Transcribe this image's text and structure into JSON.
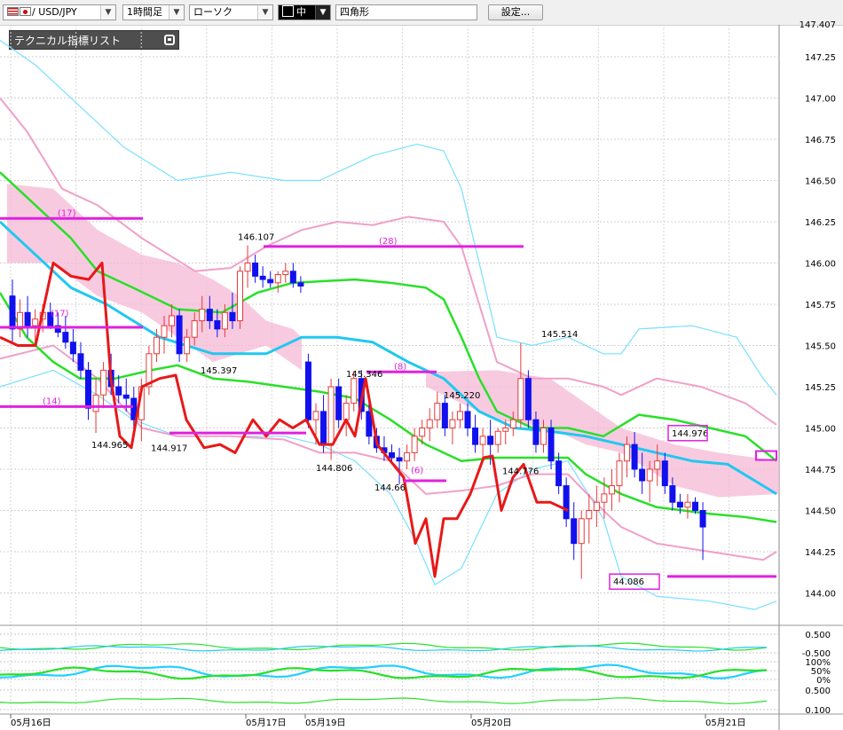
{
  "toolbar": {
    "pair": "/ USD/JPY",
    "timeframe": "1時間足",
    "chart_style": "ローソク",
    "line_width": "中",
    "shape": "四角形",
    "settings_label": "設定..."
  },
  "panel": {
    "title": "テクニカル指標リスト"
  },
  "colors": {
    "up_candle": "#e53a3a",
    "down_candle": "#1111ee",
    "cloud": "#f5b8d6",
    "ma_fast": "#28e028",
    "ma_slow": "#20c8f0",
    "bollinger_outer": "#78e0ff",
    "bollinger_pink": "#f0a0c8",
    "rci_line": "#e81818",
    "annotation": "#e020e0"
  },
  "chart_data": {
    "type": "candlestick",
    "y_range": [
      143.95,
      147.5
    ],
    "y_ticks": [
      "147.25",
      "147.00",
      "146.75",
      "146.50",
      "146.25",
      "146.00",
      "145.75",
      "145.50",
      "145.25",
      "145.00",
      "144.75",
      "144.50",
      "144.25",
      "144.00"
    ],
    "y_top_partial_label": "147.407",
    "x_labels": [
      "05月16日",
      "05月17日",
      "05月19日",
      "05月20日",
      "05月21日"
    ],
    "x_label_slots": [
      0,
      32,
      39,
      64,
      95
    ],
    "slot_count": 101,
    "candles": [
      [
        145.8,
        145.9,
        145.52,
        145.6
      ],
      [
        145.6,
        145.78,
        145.55,
        145.7
      ],
      [
        145.7,
        145.8,
        145.55,
        145.62
      ],
      [
        145.62,
        145.72,
        145.5,
        145.66
      ],
      [
        145.66,
        145.75,
        145.58,
        145.7
      ],
      [
        145.7,
        145.76,
        145.6,
        145.62
      ],
      [
        145.62,
        145.7,
        145.55,
        145.58
      ],
      [
        145.58,
        145.68,
        145.48,
        145.52
      ],
      [
        145.52,
        145.6,
        145.4,
        145.45
      ],
      [
        145.45,
        145.52,
        145.3,
        145.35
      ],
      [
        145.35,
        145.4,
        145.05,
        145.12
      ],
      [
        145.1,
        145.3,
        144.97,
        145.2
      ],
      [
        145.2,
        145.4,
        145.12,
        145.35
      ],
      [
        145.35,
        145.45,
        145.2,
        145.25
      ],
      [
        145.25,
        145.32,
        145.15,
        145.2
      ],
      [
        145.2,
        145.3,
        145.1,
        145.18
      ],
      [
        145.18,
        145.25,
        145.0,
        145.05
      ],
      [
        145.05,
        145.3,
        144.92,
        145.25
      ],
      [
        145.25,
        145.5,
        145.2,
        145.45
      ],
      [
        145.45,
        145.6,
        145.4,
        145.55
      ],
      [
        145.55,
        145.68,
        145.45,
        145.62
      ],
      [
        145.62,
        145.75,
        145.55,
        145.68
      ],
      [
        145.68,
        145.72,
        145.4,
        145.45
      ],
      [
        145.45,
        145.6,
        145.4,
        145.55
      ],
      [
        145.55,
        145.7,
        145.5,
        145.65
      ],
      [
        145.65,
        145.8,
        145.58,
        145.72
      ],
      [
        145.72,
        145.8,
        145.6,
        145.65
      ],
      [
        145.65,
        145.72,
        145.55,
        145.6
      ],
      [
        145.6,
        145.75,
        145.55,
        145.7
      ],
      [
        145.7,
        145.82,
        145.6,
        145.65
      ],
      [
        145.65,
        145.98,
        145.6,
        145.95
      ],
      [
        145.95,
        146.107,
        145.85,
        146.0
      ],
      [
        146.0,
        146.05,
        145.88,
        145.92
      ],
      [
        145.92,
        145.98,
        145.85,
        145.9
      ],
      [
        145.9,
        145.95,
        145.85,
        145.88
      ],
      [
        145.88,
        145.95,
        145.82,
        145.93
      ],
      [
        145.93,
        146.0,
        145.88,
        145.95
      ],
      [
        145.95,
        146.0,
        145.85,
        145.88
      ],
      [
        145.88,
        145.92,
        145.82,
        145.86
      ],
      [
        145.4,
        145.45,
        145.0,
        145.05
      ],
      [
        145.05,
        145.15,
        144.9,
        145.1
      ],
      [
        145.1,
        145.2,
        144.85,
        144.9
      ],
      [
        144.9,
        145.3,
        144.806,
        145.25
      ],
      [
        145.25,
        145.3,
        145.0,
        145.05
      ],
      [
        145.05,
        145.2,
        144.95,
        145.15
      ],
      [
        145.15,
        145.346,
        145.1,
        145.3
      ],
      [
        145.3,
        145.35,
        145.05,
        145.1
      ],
      [
        145.1,
        145.15,
        144.9,
        144.95
      ],
      [
        144.95,
        145.0,
        144.85,
        144.88
      ],
      [
        144.88,
        144.95,
        144.8,
        144.85
      ],
      [
        144.85,
        144.9,
        144.8,
        144.82
      ],
      [
        144.82,
        144.88,
        144.66,
        144.8
      ],
      [
        144.8,
        144.9,
        144.75,
        144.85
      ],
      [
        144.85,
        145.0,
        144.8,
        144.95
      ],
      [
        144.95,
        145.05,
        144.9,
        145.0
      ],
      [
        145.0,
        145.12,
        144.92,
        145.05
      ],
      [
        145.05,
        145.22,
        145.0,
        145.15
      ],
      [
        145.15,
        145.2,
        144.95,
        145.0
      ],
      [
        145.0,
        145.1,
        144.9,
        145.05
      ],
      [
        145.05,
        145.15,
        145.0,
        145.1
      ],
      [
        145.1,
        145.15,
        144.95,
        145.0
      ],
      [
        145.0,
        145.08,
        144.85,
        144.9
      ],
      [
        144.9,
        145.0,
        144.8,
        144.95
      ],
      [
        144.95,
        145.05,
        144.776,
        144.9
      ],
      [
        144.9,
        145.0,
        144.85,
        144.98
      ],
      [
        144.98,
        145.05,
        144.9,
        145.0
      ],
      [
        145.0,
        145.1,
        144.95,
        145.05
      ],
      [
        145.05,
        145.514,
        145.0,
        145.3
      ],
      [
        145.3,
        145.35,
        145.0,
        145.05
      ],
      [
        145.05,
        145.1,
        144.85,
        144.9
      ],
      [
        144.9,
        145.05,
        144.85,
        145.0
      ],
      [
        145.0,
        145.05,
        144.75,
        144.8
      ],
      [
        144.8,
        144.85,
        144.6,
        144.65
      ],
      [
        144.65,
        144.7,
        144.4,
        144.45
      ],
      [
        144.45,
        144.55,
        144.2,
        144.3
      ],
      [
        144.3,
        144.5,
        144.086,
        144.45
      ],
      [
        144.45,
        144.6,
        144.3,
        144.5
      ],
      [
        144.5,
        144.65,
        144.4,
        144.55
      ],
      [
        144.55,
        144.7,
        144.45,
        144.6
      ],
      [
        144.6,
        144.75,
        144.5,
        144.65
      ],
      [
        144.65,
        144.85,
        144.55,
        144.8
      ],
      [
        144.8,
        144.95,
        144.7,
        144.9
      ],
      [
        144.9,
        144.976,
        144.7,
        144.75
      ],
      [
        144.75,
        144.85,
        144.6,
        144.68
      ],
      [
        144.68,
        144.8,
        144.55,
        144.75
      ],
      [
        144.75,
        144.9,
        144.65,
        144.8
      ],
      [
        144.8,
        144.85,
        144.6,
        144.65
      ],
      [
        144.65,
        144.7,
        144.5,
        144.55
      ],
      [
        144.55,
        144.6,
        144.48,
        144.52
      ],
      [
        144.52,
        144.6,
        144.45,
        144.55
      ],
      [
        144.55,
        144.58,
        144.48,
        144.5
      ],
      [
        144.5,
        144.55,
        144.2,
        144.4
      ]
    ],
    "ma_fast": [
      [
        0,
        146.48
      ],
      [
        6,
        146.28
      ],
      [
        12,
        146.02
      ],
      [
        18,
        145.82
      ],
      [
        24,
        145.65
      ],
      [
        30,
        145.6
      ],
      [
        36,
        145.78
      ],
      [
        42,
        145.82
      ],
      [
        48,
        145.8
      ],
      [
        54,
        145.75
      ],
      [
        60,
        145.5
      ],
      [
        66,
        145.2
      ],
      [
        72,
        144.95
      ],
      [
        78,
        144.82
      ],
      [
        84,
        144.78
      ],
      [
        90,
        144.78
      ],
      [
        96,
        144.55
      ],
      [
        102,
        144.45
      ],
      [
        108,
        144.46
      ],
      [
        114,
        144.48
      ],
      [
        120,
        144.58
      ],
      [
        126,
        144.78
      ],
      [
        132,
        144.74
      ],
      [
        138,
        144.55
      ],
      [
        144,
        144.41
      ],
      [
        150,
        144.3
      ],
      [
        156,
        144.2
      ],
      [
        162,
        144.16
      ],
      [
        168,
        144.1
      ],
      [
        174,
        144.06
      ],
      [
        180,
        144.05
      ],
      [
        186,
        144.0
      ],
      [
        190,
        144.02
      ]
    ],
    "ma_slow": [
      [
        0,
        145.9
      ],
      [
        10,
        145.7
      ],
      [
        20,
        145.6
      ],
      [
        30,
        145.55
      ],
      [
        40,
        145.55
      ],
      [
        50,
        145.6
      ],
      [
        60,
        145.55
      ],
      [
        70,
        145.4
      ],
      [
        80,
        145.2
      ],
      [
        90,
        145.05
      ],
      [
        100,
        144.95
      ],
      [
        110,
        144.9
      ],
      [
        120,
        144.85
      ],
      [
        130,
        144.78
      ],
      [
        140,
        144.7
      ],
      [
        150,
        144.65
      ],
      [
        160,
        144.62
      ],
      [
        170,
        144.6
      ],
      [
        180,
        144.55
      ],
      [
        190,
        144.5
      ]
    ],
    "annotations": [
      {
        "text": "146.107",
        "value": 146.107,
        "kind": "high"
      },
      {
        "text": "145.397",
        "value": 145.397,
        "kind": "low"
      },
      {
        "text": "144.965",
        "value": 144.965,
        "kind": "low"
      },
      {
        "text": "144.917",
        "value": 144.917,
        "kind": "low"
      },
      {
        "text": "144.806",
        "value": 144.806,
        "kind": "low"
      },
      {
        "text": "145.346",
        "value": 145.346,
        "kind": "high"
      },
      {
        "text": "144.66",
        "value": 144.66,
        "kind": "low"
      },
      {
        "text": "145.220",
        "value": 145.22,
        "kind": "high"
      },
      {
        "text": "144.776",
        "value": 144.776,
        "kind": "low"
      },
      {
        "text": "145.514",
        "value": 145.514,
        "kind": "high"
      },
      {
        "text": "44.086",
        "value": 144.086,
        "kind": "low_boxed"
      },
      {
        "text": "144.976",
        "value": 144.976,
        "kind": "high_boxed"
      }
    ],
    "period_labels": [
      "(17)",
      "(28)",
      "(17)",
      "(14)",
      "(8)",
      "(6)"
    ],
    "sub_axis_labels": [
      "0.500",
      "-0.500",
      "100%",
      "50%",
      "0%",
      "0.500",
      "0.100"
    ]
  }
}
